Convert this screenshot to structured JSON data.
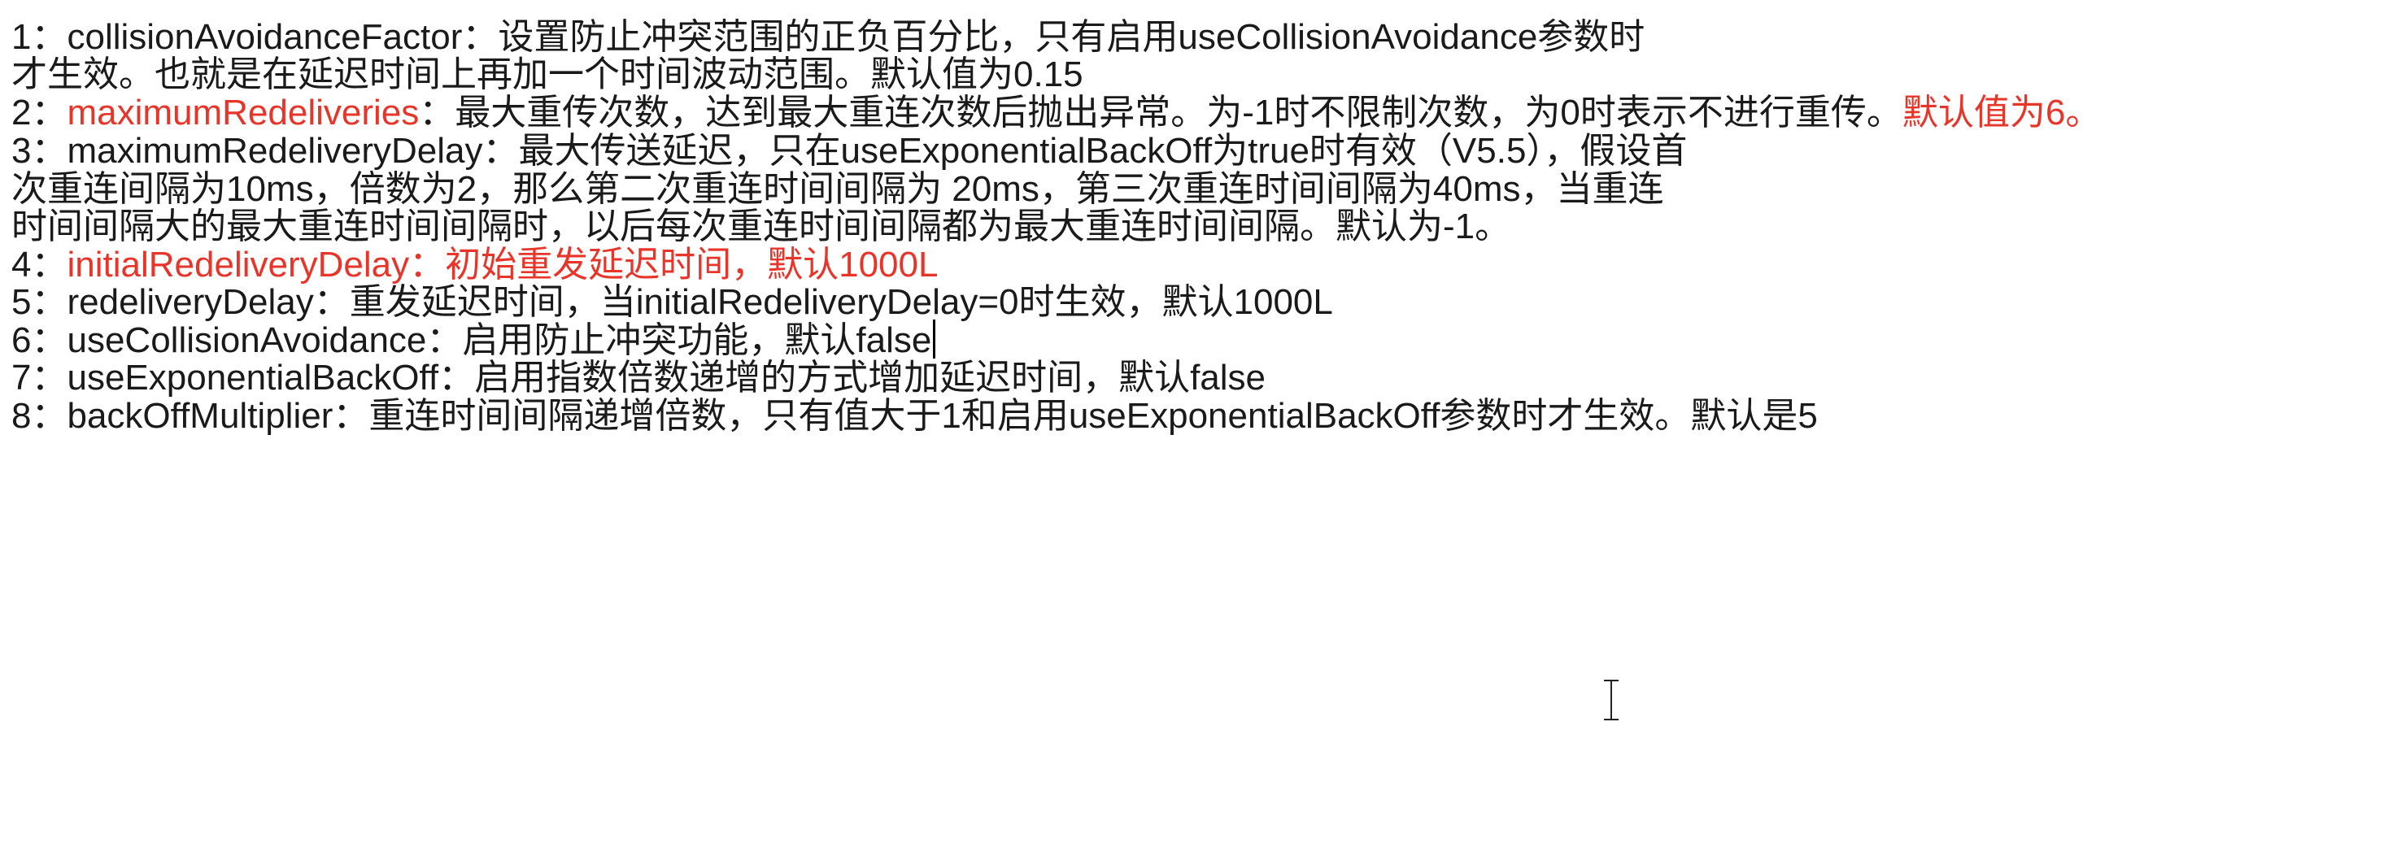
{
  "colors": {
    "text": "#1a1a1a",
    "highlight": "#e8352a",
    "background": "#ffffff"
  },
  "lines": [
    {
      "num": "1：",
      "name": "collisionAvoidanceFactor",
      "sep": "：",
      "desc": "设置防止冲突范围的正负百分比，只有启用useCollisionAvoidance参数时"
    },
    {
      "text": "才生效。也就是在延迟时间上再加一个时间波动范围。默认值为0.15"
    },
    {
      "num": "2：",
      "name": "maximumRedeliveries",
      "desc": "：最大重传次数，达到最大重连次数后抛出异常。为-1时不限制次数，为0时表示不进行重传。",
      "default": "默认值为6。"
    },
    {
      "num": "3：",
      "name": "maximumRedeliveryDelay",
      "sep": "：",
      "desc": "最大传送延迟，只在useExponentialBackOff为true时有效（V5.5），假设首"
    },
    {
      "text": "次重连间隔为10ms，倍数为2，那么第二次重连时间间隔为 20ms，第三次重连时间间隔为40ms，当重连"
    },
    {
      "text": "时间间隔大的最大重连时间间隔时，以后每次重连时间间隔都为最大重连时间间隔。默认为-1。"
    },
    {
      "num": "4：",
      "name": "initialRedeliveryDelay",
      "sep": "：",
      "desc": "初始重发延迟时间，默认1000L"
    },
    {
      "num": "5：",
      "name": "redeliveryDelay",
      "sep": "：",
      "desc": "重发延迟时间，当initialRedeliveryDelay=0时生效，默认1000L"
    },
    {
      "num": "6：",
      "name": "useCollisionAvoidance",
      "sep": "：",
      "desc": "启用防止冲突功能，默认false"
    },
    {
      "num": "7：",
      "name": "useExponentialBackOff",
      "sep": "：",
      "desc": "启用指数倍数递增的方式增加延迟时间，默认false"
    },
    {
      "num": "8：",
      "name": "backOffMultiplier",
      "sep": "：",
      "desc": "重连时间间隔递增倍数，只有值大于1和启用useExponentialBackOff参数时才生效。默认是5"
    }
  ]
}
